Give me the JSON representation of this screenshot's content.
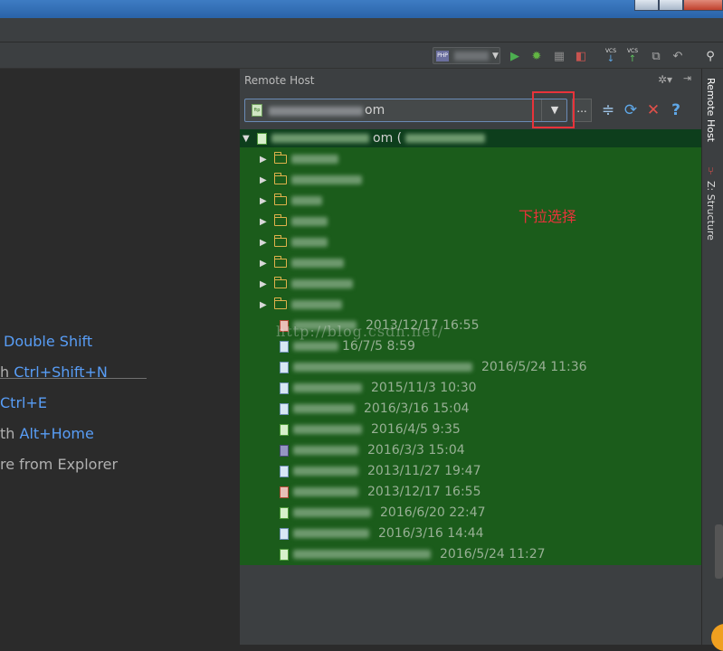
{
  "toolbar": {
    "php_badge": "PHP",
    "vcs_label": "VCS"
  },
  "left": {
    "hints": [
      {
        "prefix": "",
        "key": "Double Shift"
      },
      {
        "prefix": "h",
        "key": "Ctrl+Shift+N"
      },
      {
        "prefix": "",
        "key": "Ctrl+E"
      },
      {
        "prefix": "th",
        "key": "Alt+Home"
      },
      {
        "prefix": "re from Explorer",
        "key": ""
      }
    ]
  },
  "panel": {
    "title": "Remote Host",
    "host_suffix": "om",
    "dropdown_arrow": "▼",
    "ellipsis": "...",
    "root_suffix": "om (",
    "annotation": "下拉选择",
    "watermark": "http://blog.csdn.net/"
  },
  "files": [
    {
      "date": "2013/12/17 16:55",
      "kind": "red"
    },
    {
      "date": "16/7/5 8:59",
      "kind": "doc"
    },
    {
      "date": "2016/5/24 11:36",
      "kind": "doc"
    },
    {
      "date": "2015/11/3 10:30",
      "kind": "unknown"
    },
    {
      "date": "2016/3/16 15:04",
      "kind": "unknown"
    },
    {
      "date": "2016/4/5 9:35",
      "kind": "green"
    },
    {
      "date": "2016/3/3 15:04",
      "kind": "php"
    },
    {
      "date": "2013/11/27 19:47",
      "kind": "doc"
    },
    {
      "date": "2013/12/17 16:55",
      "kind": "red"
    },
    {
      "date": "2016/6/20 22:47",
      "kind": "green"
    },
    {
      "date": "2016/3/16 14:44",
      "kind": "unknown"
    },
    {
      "date": "2016/5/24 11:27",
      "kind": "green"
    }
  ],
  "right_tabs": {
    "remote_host": "Remote Host",
    "structure": "Z: Structure"
  },
  "colors": {
    "tree_bg": "#1b5c1b",
    "accent_link": "#589df6",
    "highlight_red": "#e8333a"
  }
}
